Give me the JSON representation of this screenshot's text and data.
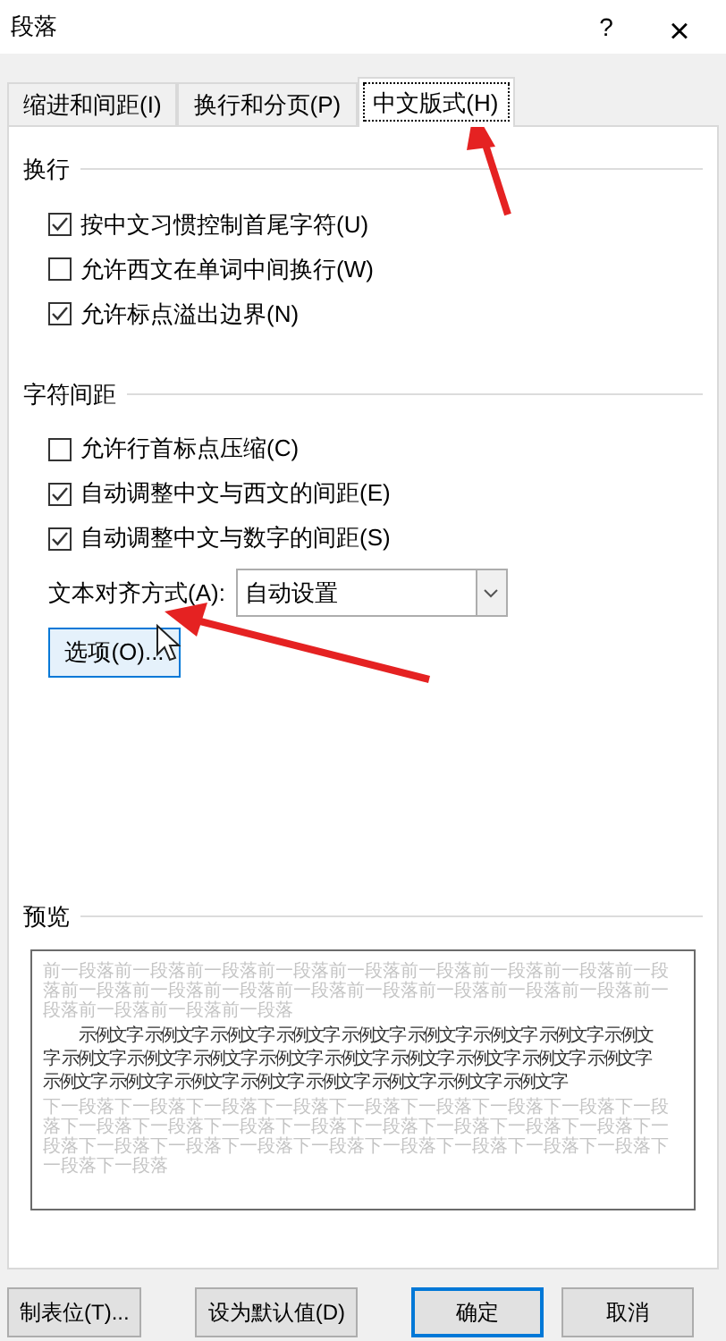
{
  "window": {
    "title": "段落",
    "help": "?",
    "close": "×"
  },
  "tabs": [
    {
      "label": "缩进和间距(I)",
      "selected": false
    },
    {
      "label": "换行和分页(P)",
      "selected": false
    },
    {
      "label": "中文版式(H)",
      "selected": true
    }
  ],
  "sections": [
    {
      "title": "换行",
      "options": [
        {
          "label": "按中文习惯控制首尾字符(U)",
          "checked": true
        },
        {
          "label": "允许西文在单词中间换行(W)",
          "checked": false
        },
        {
          "label": "允许标点溢出边界(N)",
          "checked": true
        }
      ]
    },
    {
      "title": "字符间距",
      "options": [
        {
          "label": "允许行首标点压缩(C)",
          "checked": false
        },
        {
          "label": "自动调整中文与西文的间距(E)",
          "checked": true
        },
        {
          "label": "自动调整中文与数字的间距(S)",
          "checked": true
        }
      ]
    }
  ],
  "alignment": {
    "label": "文本对齐方式(A):",
    "value": "自动设置"
  },
  "options_button": "选项(O)...",
  "preview": {
    "title": "预览",
    "previous": "前一段落前一段落前一段落前一段落前一段落前一段落前一段落前一段落前一段落前一段落前一段落前一段落前一段落前一段落前一段落前一段落前一段落前一段落前一段落前一段落前一段落",
    "sample": [
      "示例文字 示例文字 示例文字 示例文字 示例文字 示例文字 示例文字 示例文字 示例文",
      "字 示例文字 示例文字 示例文字 示例文字 示例文字 示例文字 示例文字 示例文字 示例文字",
      "示例文字 示例文字 示例文字 示例文字 示例文字 示例文字 示例文字 示例文字"
    ],
    "next": "下一段落下一段落下一段落下一段落下一段落下一段落下一段落下一段落下一段落下一段落下一段落下一段落下一段落下一段落下一段落下一段落下一段落下一段落下一段落下一段落下一段落下一段落下一段落下一段落下一段落下一段落下一段落下一段落"
  },
  "buttons": [
    {
      "label": "制表位(T)...",
      "default": false
    },
    {
      "label": "设为默认值(D)",
      "default": false
    },
    {
      "label": "确定",
      "default": true
    },
    {
      "label": "取消",
      "default": false
    }
  ]
}
